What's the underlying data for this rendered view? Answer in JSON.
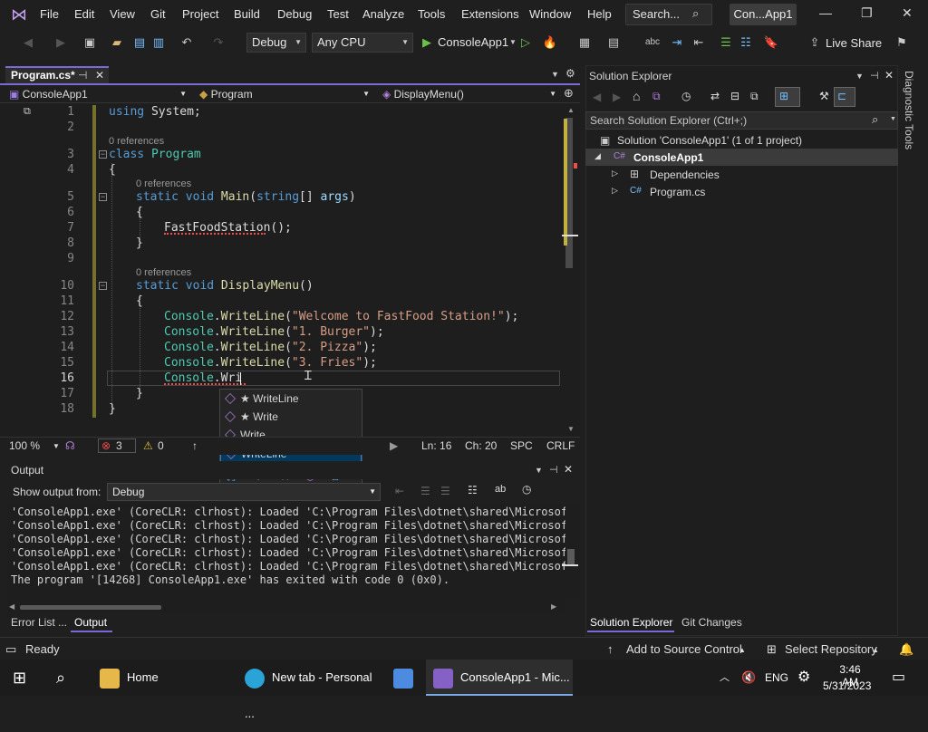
{
  "menubar": {
    "items": [
      "File",
      "Edit",
      "View",
      "Git",
      "Project",
      "Build",
      "Debug",
      "Test",
      "Analyze",
      "Tools",
      "Extensions",
      "Window",
      "Help"
    ],
    "search_label": "Search...",
    "solution_name": "Con...App1"
  },
  "toolbar": {
    "config": "Debug",
    "platform": "Any CPU",
    "start_label": "ConsoleApp1",
    "live_share": "Live Share"
  },
  "editor": {
    "tab_name": "Program.cs*",
    "nav_project": "ConsoleApp1",
    "nav_class": "Program",
    "nav_member": "DisplayMenu()",
    "refs_label": "0 references",
    "line_numbers": [
      "1",
      "2",
      "3",
      "4",
      "5",
      "6",
      "7",
      "8",
      "9",
      "10",
      "11",
      "12",
      "13",
      "14",
      "15",
      "16",
      "17",
      "18"
    ],
    "lines": {
      "l1_kw": "using",
      "l1_rest": " System;",
      "l3_kw": "class",
      "l3_ty": "Program",
      "l4": "{",
      "l5_kw": "static void",
      "l5_fn": "Main",
      "l5_a": "(",
      "l5_kw2": "string",
      "l5_b": "[] ",
      "l5_pr": "args",
      "l5_c": ")",
      "l6": "{",
      "l7_fn": "FastFoodStation",
      "l7_rest": "();",
      "l8": "}",
      "l10_kw": "static void",
      "l10_fn": "DisplayMenu",
      "l10_rest": "()",
      "l11": "{",
      "l12_ty": "Console",
      "l12_fn": "WriteLine",
      "l12_st": "\"Welcome to FastFood Station!\"",
      "l13_ty": "Console",
      "l13_fn": "WriteLine",
      "l13_st": "\"1. Burger\"",
      "l14_ty": "Console",
      "l14_fn": "WriteLine",
      "l14_st": "\"2. Pizza\"",
      "l15_ty": "Console",
      "l15_fn": "WriteLine",
      "l15_st": "\"3. Fries\"",
      "l16_ty": "Console",
      "l16_rest": "Wri",
      "l17": "}",
      "l18": "}"
    },
    "autocomplete": [
      "★ WriteLine",
      "★ Write",
      "Write",
      "WriteLine"
    ],
    "status": {
      "zoom": "100 %",
      "errors": "3",
      "warnings": "0",
      "line": "Ln: 16",
      "col": "Ch: 20",
      "spc": "SPC",
      "eol": "CRLF"
    }
  },
  "output": {
    "title": "Output",
    "show_from_label": "Show output from:",
    "source": "Debug",
    "lines": [
      "'ConsoleApp1.exe' (CoreCLR: clrhost): Loaded 'C:\\Program Files\\dotnet\\shared\\Microsoft",
      "'ConsoleApp1.exe' (CoreCLR: clrhost): Loaded 'C:\\Program Files\\dotnet\\shared\\Microsoft",
      "'ConsoleApp1.exe' (CoreCLR: clrhost): Loaded 'C:\\Program Files\\dotnet\\shared\\Microsoft",
      "'ConsoleApp1.exe' (CoreCLR: clrhost): Loaded 'C:\\Program Files\\dotnet\\shared\\Microsoft",
      "'ConsoleApp1.exe' (CoreCLR: clrhost): Loaded 'C:\\Program Files\\dotnet\\shared\\Microsoft",
      "The program '[14268] ConsoleApp1.exe' has exited with code 0 (0x0)."
    ],
    "tabs": [
      "Error List ...",
      "Output"
    ]
  },
  "solution_explorer": {
    "title": "Solution Explorer",
    "search_placeholder": "Search Solution Explorer (Ctrl+;)",
    "solution_node": "Solution 'ConsoleApp1' (1 of 1 project)",
    "project_node": "ConsoleApp1",
    "dependencies": "Dependencies",
    "file": "Program.cs",
    "tabs": [
      "Solution Explorer",
      "Git Changes"
    ],
    "diagnostic_tools": "Diagnostic Tools"
  },
  "statusbar": {
    "ready": "Ready",
    "add_source": "Add to Source Control",
    "select_repo": "Select Repository"
  },
  "taskbar": {
    "home": "Home",
    "edge": "New tab - Personal ...",
    "vs": "ConsoleApp1 - Mic...",
    "lang": "ENG",
    "time": "3:46 AM",
    "date": "5/31/2023"
  }
}
